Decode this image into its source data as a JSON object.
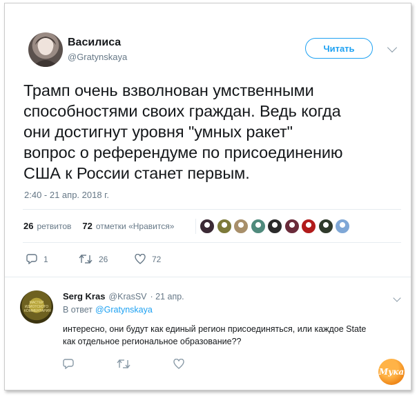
{
  "tweet": {
    "author_name": "Василиса",
    "author_handle": "@Gratynskaya",
    "follow_label": "Читать",
    "text_lines": [
      "Трамп очень взволнован умственными",
      "способностями своих граждан. Ведь когда",
      "они достигнут уровня \"умных ракет\"",
      "вопрос о референдуме по присоединению",
      "США к России станет первым."
    ],
    "timestamp": "2:40 - 21 апр. 2018 г."
  },
  "stats": {
    "retweets_count": "26",
    "retweets_label": "ретвитов",
    "likes_count": "72",
    "likes_label": "отметки «Нравится»"
  },
  "likers": [
    {
      "color": "#3b2a35"
    },
    {
      "color": "#7d7a3a"
    },
    {
      "color": "#a88f6a"
    },
    {
      "color": "#4f8a7c"
    },
    {
      "color": "#2b2b2b"
    },
    {
      "color": "#6a2b3a"
    },
    {
      "color": "#b11b1b"
    },
    {
      "color": "#2f3a2b"
    },
    {
      "color": "#7fa7d6"
    }
  ],
  "actions": {
    "reply_count": "1",
    "retweet_count": "26",
    "like_count": "72"
  },
  "reply": {
    "avatar_text": "МАСТЕР ИДИОТСКОГО КОММЕНТАРИЯ",
    "author_name": "Serg Kras",
    "author_handle": "@KrasSV",
    "date": "· 21 апр.",
    "in_reply_label": "В ответ",
    "in_reply_handle": "@Gratynskaya",
    "text_line1": "интересно, они будут как единый регион присоединяться, или каждое State",
    "text_line2": "как отдельное региональное образование??"
  },
  "watermark": "Мука"
}
